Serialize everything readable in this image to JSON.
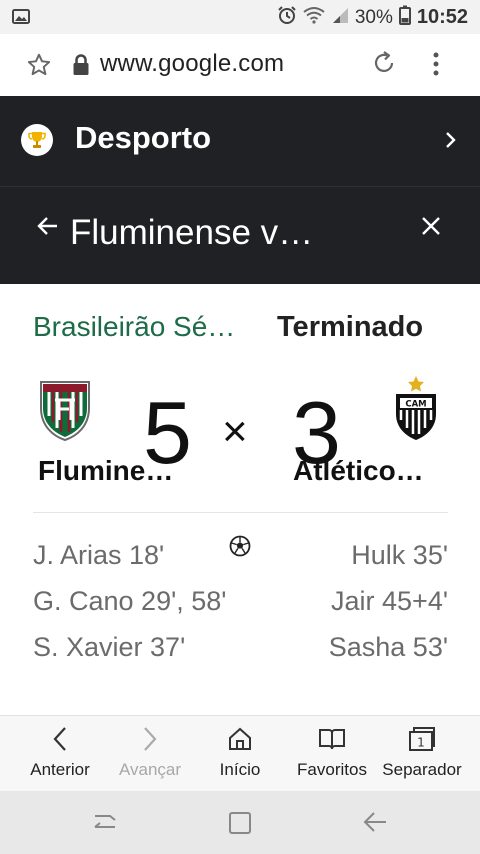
{
  "status_bar": {
    "battery": "30%",
    "time": "10:52",
    "icons": [
      "gallery-icon",
      "alarm-icon",
      "wifi-icon",
      "signal-icon",
      "battery-icon"
    ]
  },
  "browser": {
    "url": "www.google.com",
    "icons": [
      "star-icon",
      "lock-icon",
      "reload-icon",
      "menu-icon"
    ]
  },
  "header": {
    "section_title": "Desporto",
    "match_title": "Fluminense v…"
  },
  "match": {
    "league": "Brasileirão Sé…",
    "status": "Terminado",
    "home_team": "Flumine…",
    "away_team": "Atlético…",
    "home_score": "5",
    "away_score": "3",
    "separator": "×",
    "home_scorers": [
      "J. Arias 18'",
      "G. Cano 29', 58'",
      "S. Xavier 37'"
    ],
    "away_scorers": [
      "Hulk 35'",
      "Jair 45+4'",
      "Sasha 53'"
    ],
    "colors": {
      "league": "#1e6b47",
      "home_crest_red": "#8b1a2b",
      "home_crest_green": "#0f6b3a"
    }
  },
  "toolbar": {
    "back": "Anterior",
    "forward": "Avançar",
    "home": "Início",
    "bookmarks": "Favoritos",
    "tabs": "Separador",
    "tabs_count": "1"
  }
}
